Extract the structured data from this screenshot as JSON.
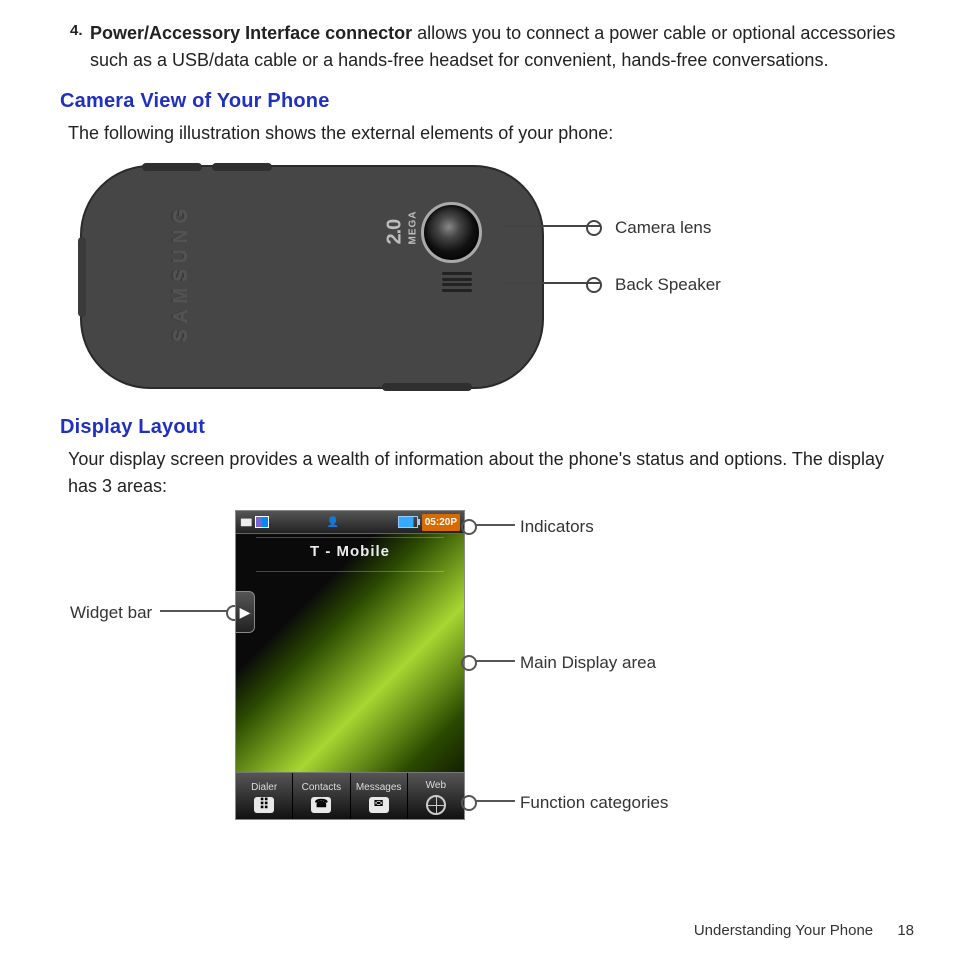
{
  "list_item": {
    "number": "4.",
    "term": "Power/Accessory Interface connector",
    "text_after_term": " allows you to connect a power cable or optional accessories such as a USB/data cable or a hands-free headset for convenient, hands-free conversations."
  },
  "section_camera": {
    "heading": "Camera View of Your Phone",
    "intro": "The following illustration shows the external elements of your phone:",
    "brand": "SAMSUNG",
    "mega_value": "2.0",
    "mega_label": "MEGA",
    "callouts": {
      "camera_lens": "Camera lens",
      "back_speaker": "Back Speaker"
    }
  },
  "section_display": {
    "heading": "Display Layout",
    "intro": "Your display screen provides a wealth of information about the phone's status and options. The display has 3 areas:",
    "status": {
      "clock": "05:20P"
    },
    "carrier": "T - Mobile",
    "widget_arrow": "▶",
    "functions": [
      {
        "label": "Dialer"
      },
      {
        "label": "Contacts"
      },
      {
        "label": "Messages"
      },
      {
        "label": "Web"
      }
    ],
    "callouts": {
      "indicators": "Indicators",
      "widget_bar": "Widget bar",
      "main_display": "Main Display area",
      "function_categories": "Function categories"
    }
  },
  "footer": {
    "section": "Understanding Your Phone",
    "page": "18"
  }
}
